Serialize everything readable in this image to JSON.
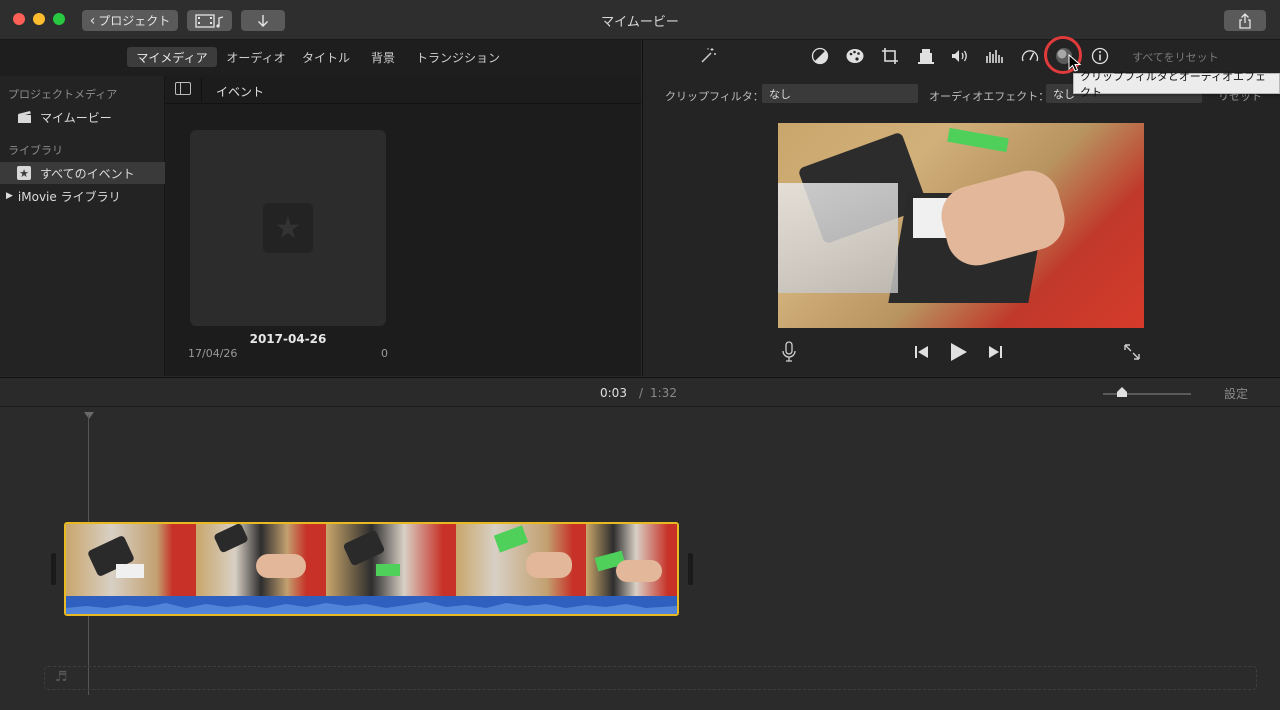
{
  "window": {
    "title": "マイムービー"
  },
  "toolbar": {
    "projects_label": "プロジェクト"
  },
  "tabs": [
    {
      "label": "マイメディア",
      "selected": true
    },
    {
      "label": "オーディオ",
      "selected": false
    },
    {
      "label": "タイトル",
      "selected": false
    },
    {
      "label": "背景",
      "selected": false
    },
    {
      "label": "トランジション",
      "selected": false
    }
  ],
  "sidebar": {
    "section_project": "プロジェクトメディア",
    "project_item": "マイムービー",
    "section_library": "ライブラリ",
    "all_events": "すべてのイベント",
    "library_item": "iMovie ライブラリ"
  },
  "browser": {
    "header": "イベント",
    "event": {
      "title": "2017-04-26",
      "date": "17/04/26",
      "count": "0"
    }
  },
  "adjust": {
    "reset_all": "すべてをリセット",
    "tooltip": "クリップフィルタとオーディオエフェクト",
    "clip_filter_label": "クリップフィルタ：",
    "clip_filter_value": "なし",
    "audio_effect_label": "オーディオエフェクト：",
    "audio_effect_value": "なし",
    "reset_partial": "リセット"
  },
  "timeline": {
    "current_time": "0:03",
    "separator": "/",
    "total_time": "1:32",
    "settings": "設定"
  },
  "colors": {
    "accent_red": "#e23b3b",
    "clip_border": "#e8b923",
    "audio_wave": "#2f5fbf"
  }
}
